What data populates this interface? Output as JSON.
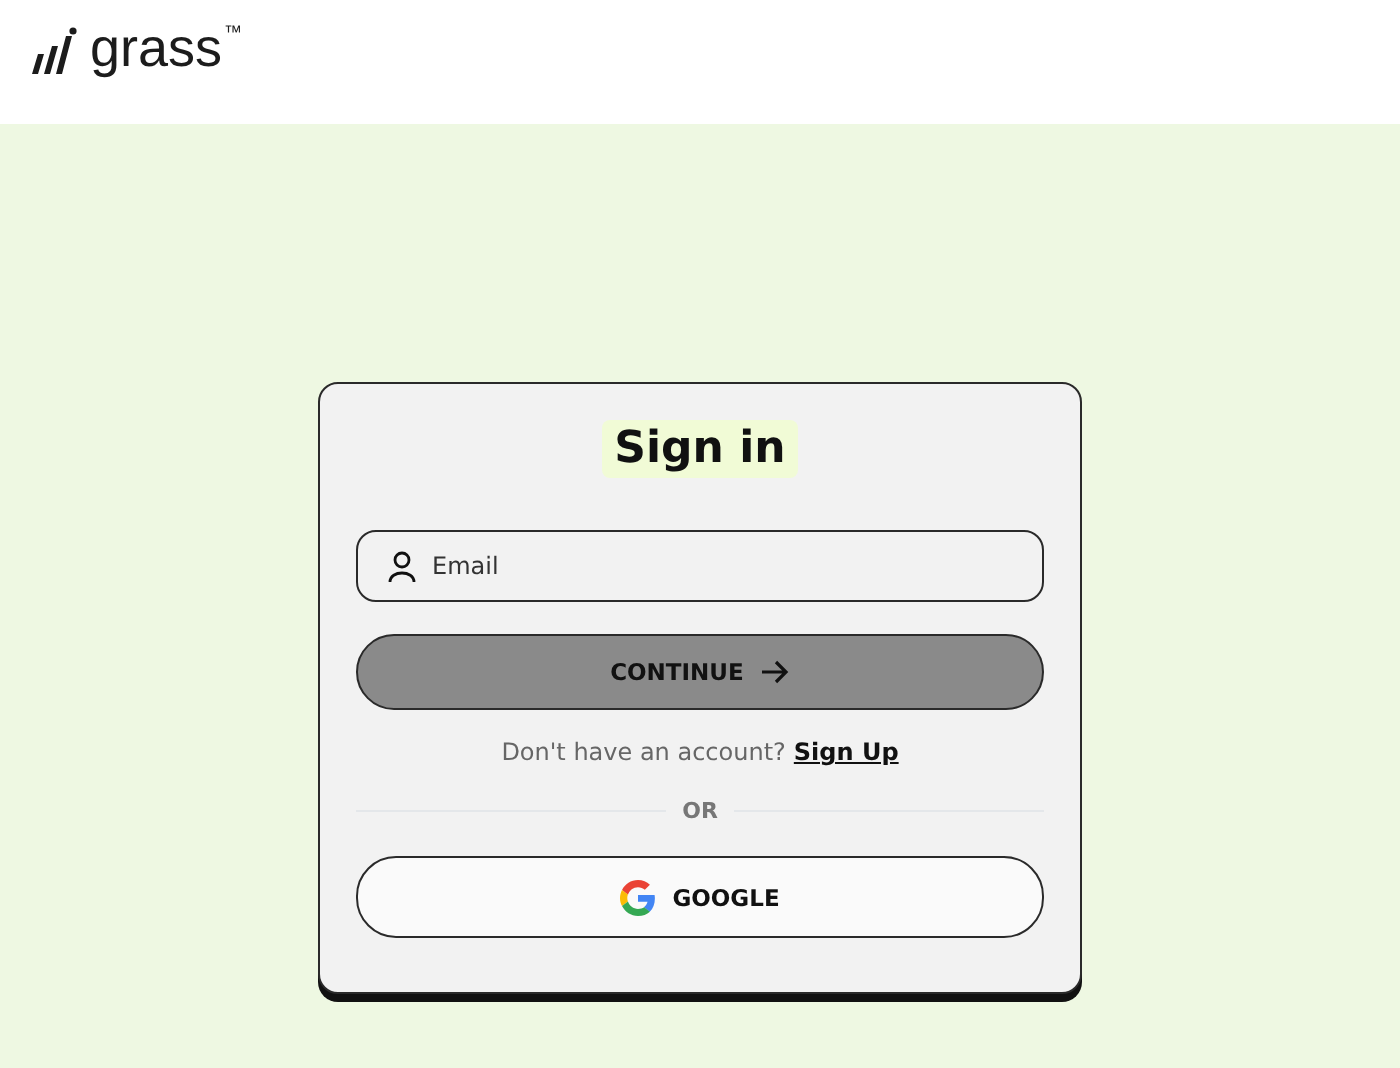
{
  "header": {
    "logo_text": "grass",
    "trademark": "™"
  },
  "sign_in": {
    "title": "Sign in",
    "email": {
      "placeholder": "Email"
    },
    "continue_button": "CONTINUE",
    "signup_prompt": "Don't have an account?",
    "signup_link": "Sign Up",
    "divider": "OR",
    "google_button": "GOOGLE"
  }
}
